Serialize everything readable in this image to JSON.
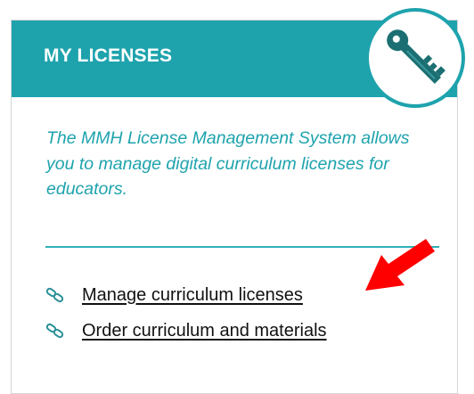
{
  "panel": {
    "title": "MY LICENSES",
    "badge_icon": "key-icon",
    "description": "The MMH License Management System allows you to manage digital curriculum licenses for educators.",
    "links": [
      {
        "label": "Manage curriculum licenses",
        "icon": "link-icon"
      },
      {
        "label": "Order curriculum and materials",
        "icon": "link-icon"
      }
    ]
  },
  "annotation": {
    "icon": "red-arrow-icon",
    "color": "#ff0000"
  },
  "colors": {
    "accent": "#1ea3ad",
    "key": "#1b6f72",
    "text": "#111111"
  }
}
